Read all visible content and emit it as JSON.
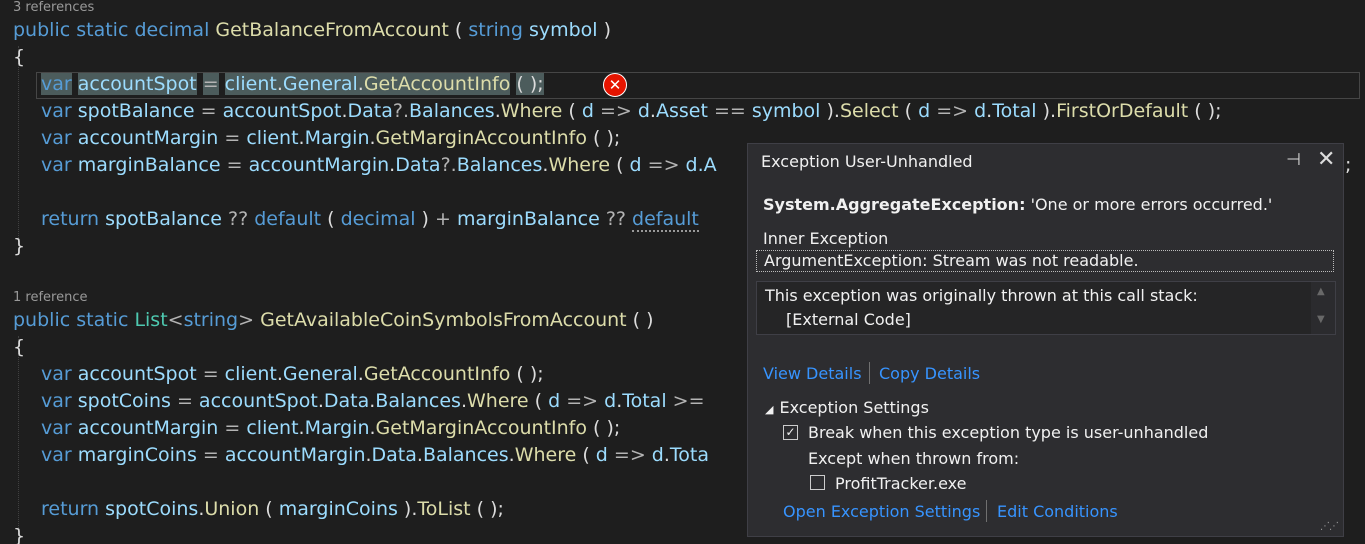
{
  "method1": {
    "codelens": "3 references",
    "sig_public": "public",
    "sig_static": "static",
    "sig_type": "decimal",
    "sig_name": "GetBalanceFromAccount",
    "sig_paramtype": "string",
    "sig_param": "symbol",
    "l1_var": "var",
    "l1_name": "accountSpot",
    "l1_client": "client",
    "l1_general": "General",
    "l1_method": "GetAccountInfo",
    "l2": {
      "var": "var",
      "name": "spotBalance",
      "a": "accountSpot",
      "data": "Data",
      "bal": "Balances",
      "where": "Where",
      "d": "d",
      "asset": "Asset",
      "sym": "symbol",
      "select": "Select",
      "total": "Total",
      "fod": "FirstOrDefault"
    },
    "l3": {
      "var": "var",
      "name": "accountMargin",
      "client": "client",
      "margin": "Margin",
      "method": "GetMarginAccountInfo"
    },
    "l4": {
      "var": "var",
      "name": "marginBalance",
      "a": "accountMargin",
      "data": "Data",
      "bal": "Balances",
      "where": "Where",
      "d": "d",
      "trail": "d.A"
    },
    "ret": {
      "kw": "return",
      "a": "spotBalance",
      "def": "default",
      "type": "decimal",
      "b": "marginBalance",
      "def2": "default"
    }
  },
  "method2": {
    "codelens": "1 reference",
    "sig_public": "public",
    "sig_static": "static",
    "sig_list": "List",
    "sig_string": "string",
    "sig_name": "GetAvailableCoinSymbolsFromAccount",
    "l1": {
      "var": "var",
      "name": "accountSpot",
      "client": "client",
      "general": "General",
      "method": "GetAccountInfo"
    },
    "l2": {
      "var": "var",
      "name": "spotCoins",
      "a": "accountSpot",
      "data": "Data",
      "bal": "Balances",
      "where": "Where",
      "d": "d",
      "total": "Total"
    },
    "l3": {
      "var": "var",
      "name": "accountMargin",
      "client": "client",
      "margin": "Margin",
      "method": "GetMarginAccountInfo"
    },
    "l4": {
      "var": "var",
      "name": "marginCoins",
      "a": "accountMargin",
      "data": "Data",
      "bal": "Balances",
      "where": "Where",
      "d": "d",
      "total": "Tota"
    },
    "ret": {
      "kw": "return",
      "a": "spotCoins",
      "union": "Union",
      "b": "marginCoins",
      "tolist": "ToList"
    }
  },
  "popup": {
    "title": "Exception User-Unhandled",
    "exception_type": "System.AggregateException:",
    "exception_message": "'One or more errors occurred.'",
    "inner_label": "Inner Exception",
    "inner_value": "ArgumentException: Stream was not readable.",
    "stack_message": "This exception was originally thrown at this call stack:",
    "stack_frame": "[External Code]",
    "view_details": "View Details",
    "copy_details": "Copy Details",
    "settings_title": "Exception Settings",
    "break_label": "Break when this exception type is user-unhandled",
    "break_checked": true,
    "except_label": "Except when thrown from:",
    "profit_label": "ProfitTracker.exe",
    "profit_checked": false,
    "open_settings": "Open Exception Settings",
    "edit_conditions": "Edit Conditions"
  }
}
